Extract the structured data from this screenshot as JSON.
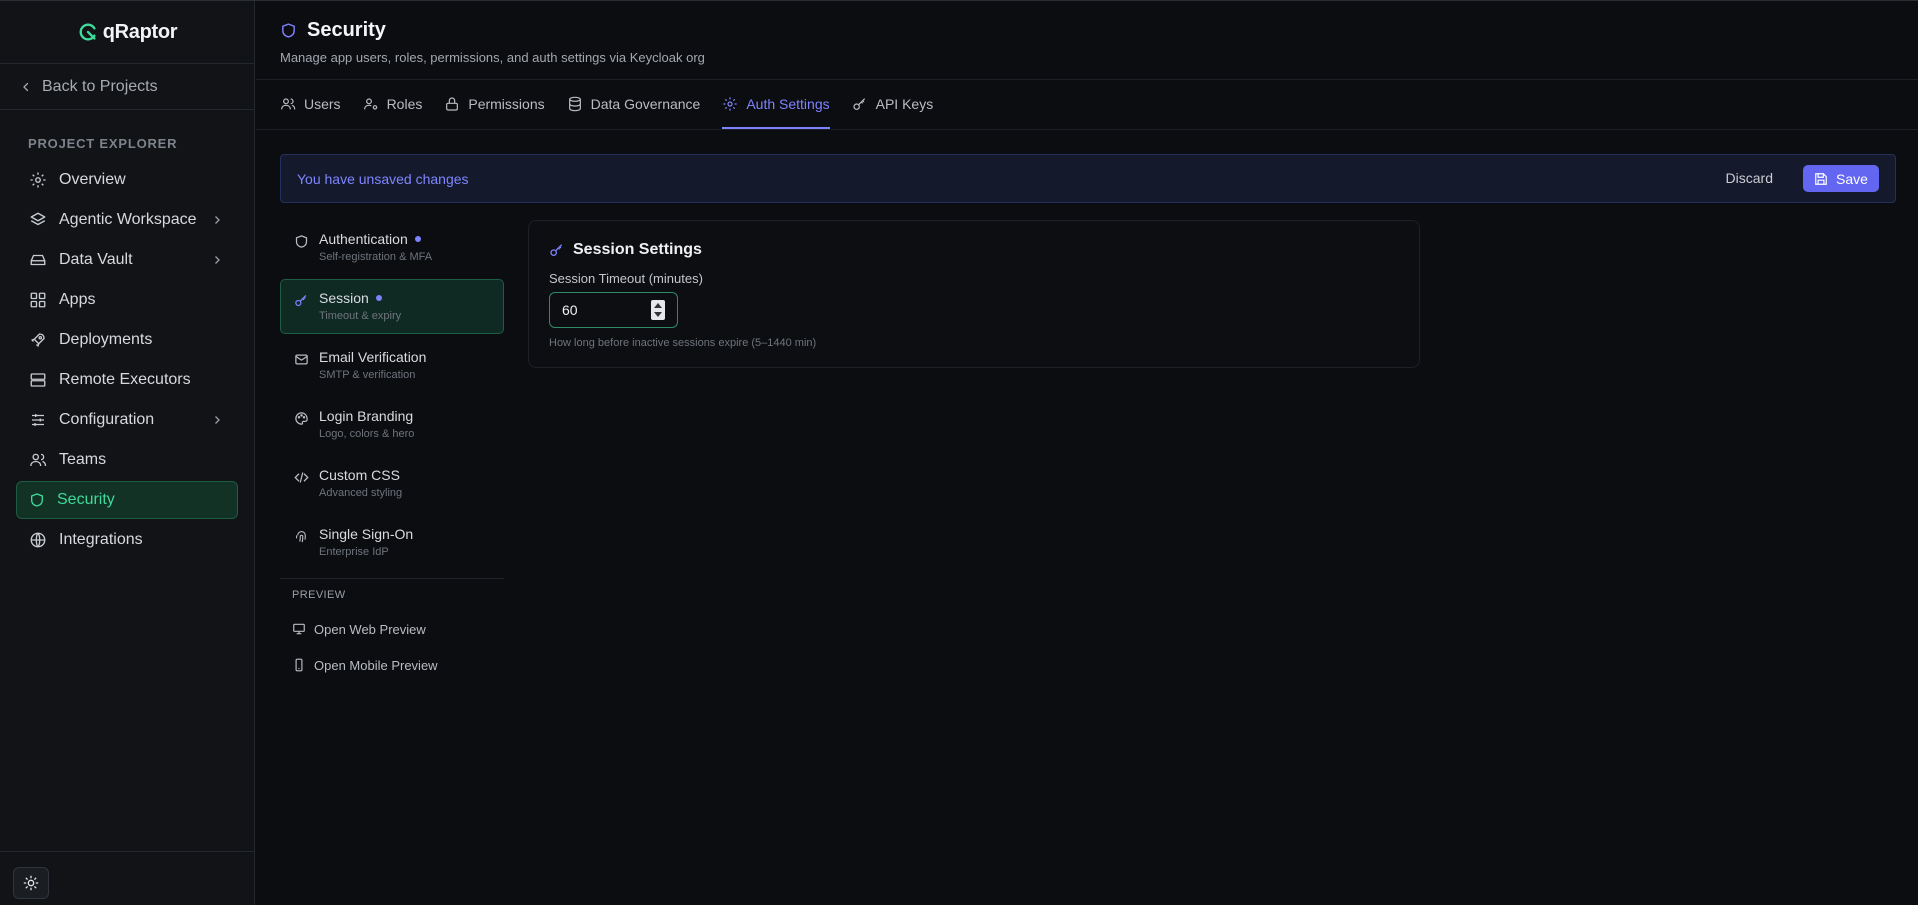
{
  "sidebar": {
    "logo_text": "qRaptor",
    "back_label": "Back to Projects",
    "section_label": "PROJECT EXPLORER",
    "items": [
      {
        "label": "Overview"
      },
      {
        "label": "Agentic Workspace"
      },
      {
        "label": "Data Vault"
      },
      {
        "label": "Apps"
      },
      {
        "label": "Deployments"
      },
      {
        "label": "Remote Executors"
      },
      {
        "label": "Configuration"
      },
      {
        "label": "Teams"
      },
      {
        "label": "Security"
      },
      {
        "label": "Integrations"
      }
    ]
  },
  "header": {
    "title": "Security",
    "subtitle": "Manage app users, roles, permissions, and auth settings via Keycloak org"
  },
  "tabs": [
    {
      "label": "Users"
    },
    {
      "label": "Roles"
    },
    {
      "label": "Permissions"
    },
    {
      "label": "Data Governance"
    },
    {
      "label": "Auth Settings"
    },
    {
      "label": "API Keys"
    }
  ],
  "banner": {
    "text": "You have unsaved changes",
    "discard_label": "Discard",
    "save_label": "Save"
  },
  "settings_nav": {
    "items": [
      {
        "title": "Authentication",
        "desc": "Self-registration & MFA"
      },
      {
        "title": "Session",
        "desc": "Timeout & expiry"
      },
      {
        "title": "Email Verification",
        "desc": "SMTP & verification"
      },
      {
        "title": "Login Branding",
        "desc": "Logo, colors & hero"
      },
      {
        "title": "Custom CSS",
        "desc": "Advanced styling"
      },
      {
        "title": "Single Sign-On",
        "desc": "Enterprise IdP"
      }
    ],
    "preview_label": "PREVIEW",
    "preview_links": [
      {
        "label": "Open Web Preview"
      },
      {
        "label": "Open Mobile Preview"
      }
    ]
  },
  "session_card": {
    "title": "Session Settings",
    "field_label": "Session Timeout (minutes)",
    "field_value": "60",
    "hint": "How long before inactive sessions expire (5–1440 min)"
  },
  "colors": {
    "accent_green": "#3fd99b",
    "accent_indigo": "#7f82ff",
    "save_button": "#6266f1",
    "background": "#0b0d10"
  }
}
